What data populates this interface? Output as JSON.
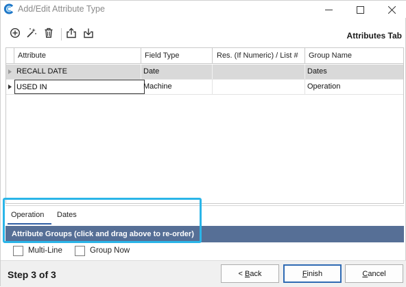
{
  "window": {
    "title": "Add/Edit Attribute Type",
    "logo_icon": "app-logo-icon",
    "controls": [
      "minimize-icon",
      "maximize-icon",
      "close-icon"
    ]
  },
  "toolbar": {
    "icons": [
      "add-icon",
      "magic-wand-icon",
      "delete-icon",
      "export-icon",
      "import-icon"
    ],
    "tab_title": "Attributes Tab"
  },
  "grid": {
    "columns": [
      "Attribute",
      "Field Type",
      "Res. (If Numeric) / List #",
      "Group Name"
    ],
    "rows": [
      {
        "attribute": "RECALL DATE",
        "field_type": "Date",
        "res": "",
        "group": "Dates"
      },
      {
        "attribute": "USED IN",
        "field_type": "Machine",
        "res": "",
        "group": "Operation"
      }
    ]
  },
  "groups": {
    "tabs": [
      "Operation",
      "Dates"
    ],
    "active_tab": "Operation",
    "bar_text": "Attribute Groups (click and drag above to re-order)",
    "multi_line_label": "Multi-Line",
    "group_now_label": "Group Now"
  },
  "footer": {
    "step_text": "Step 3 of 3",
    "back_prefix": "< ",
    "back_accel": "B",
    "back_rest": "ack",
    "finish_accel": "F",
    "finish_rest": "inish",
    "cancel_accel": "C",
    "cancel_rest": "ancel"
  },
  "colors": {
    "groups_bar": "#566f96",
    "highlight": "#2bb5e8",
    "selected_row": "#d9d9d9"
  }
}
